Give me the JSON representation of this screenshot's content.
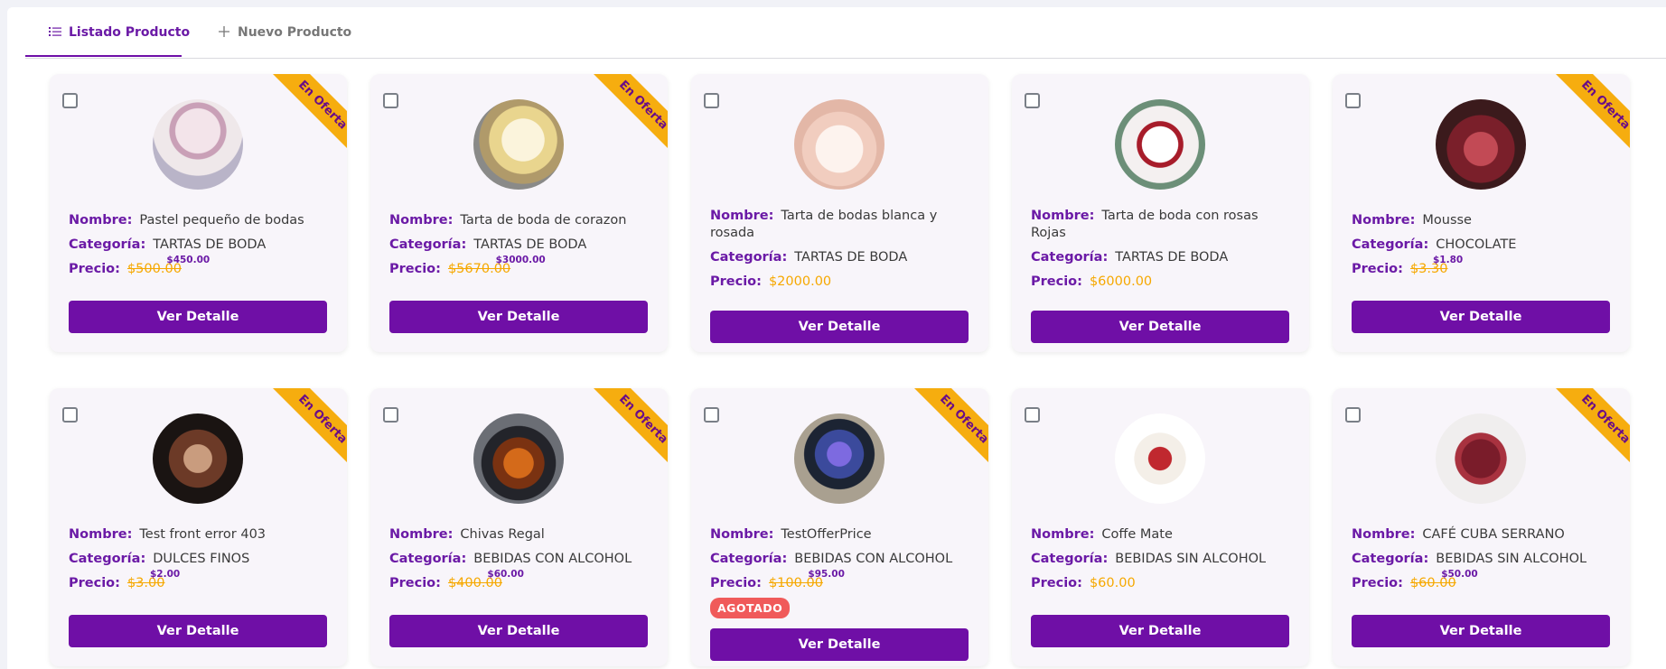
{
  "tabs": [
    {
      "label": "Listado Producto",
      "icon": "list-icon",
      "active": true
    },
    {
      "label": "Nuevo Producto",
      "icon": "plus-icon",
      "active": false
    }
  ],
  "labels": {
    "nombre": "Nombre:",
    "categoria": "Categoría:",
    "precio": "Precio:",
    "ver_detalle": "Ver Detalle",
    "en_oferta": "En Oferta",
    "agotado": "AGOTADO"
  },
  "colors": {
    "primary": "#6f0fa6",
    "accent": "#f6ad0f",
    "badge": "#f05a5a"
  },
  "products": [
    {
      "name": "Pastel pequeño de bodas",
      "category": "TARTAS DE BODA",
      "price": "$500.00",
      "offer": "$450.00"
    },
    {
      "name": "Tarta de boda de corazon",
      "category": "TARTAS DE BODA",
      "price": "$5670.00",
      "offer": "$3000.00"
    },
    {
      "name": "Tarta de bodas blanca y rosada",
      "category": "TARTAS DE BODA",
      "price": "$2000.00",
      "offer": null
    },
    {
      "name": "Tarta de boda con rosas Rojas",
      "category": "TARTAS DE BODA",
      "price": "$6000.00",
      "offer": null
    },
    {
      "name": "Mousse",
      "category": "CHOCOLATE",
      "price": "$3.30",
      "offer": "$1.80"
    },
    {
      "name": "Test front error 403",
      "category": "DULCES FINOS",
      "price": "$3.00",
      "offer": "$2.00"
    },
    {
      "name": "Chivas Regal",
      "category": "BEBIDAS CON ALCOHOL",
      "price": "$400.00",
      "offer": "$60.00"
    },
    {
      "name": "TestOfferPrice",
      "category": "BEBIDAS CON ALCOHOL",
      "price": "$100.00",
      "offer": "$95.00",
      "sold_out": true
    },
    {
      "name": "Coffe Mate",
      "category": "BEBIDAS SIN ALCOHOL",
      "price": "$60.00",
      "offer": null
    },
    {
      "name": "CAFÉ CUBA SERRANO",
      "category": "BEBIDAS SIN ALCOHOL",
      "price": "$60.00",
      "offer": "$50.00"
    }
  ]
}
